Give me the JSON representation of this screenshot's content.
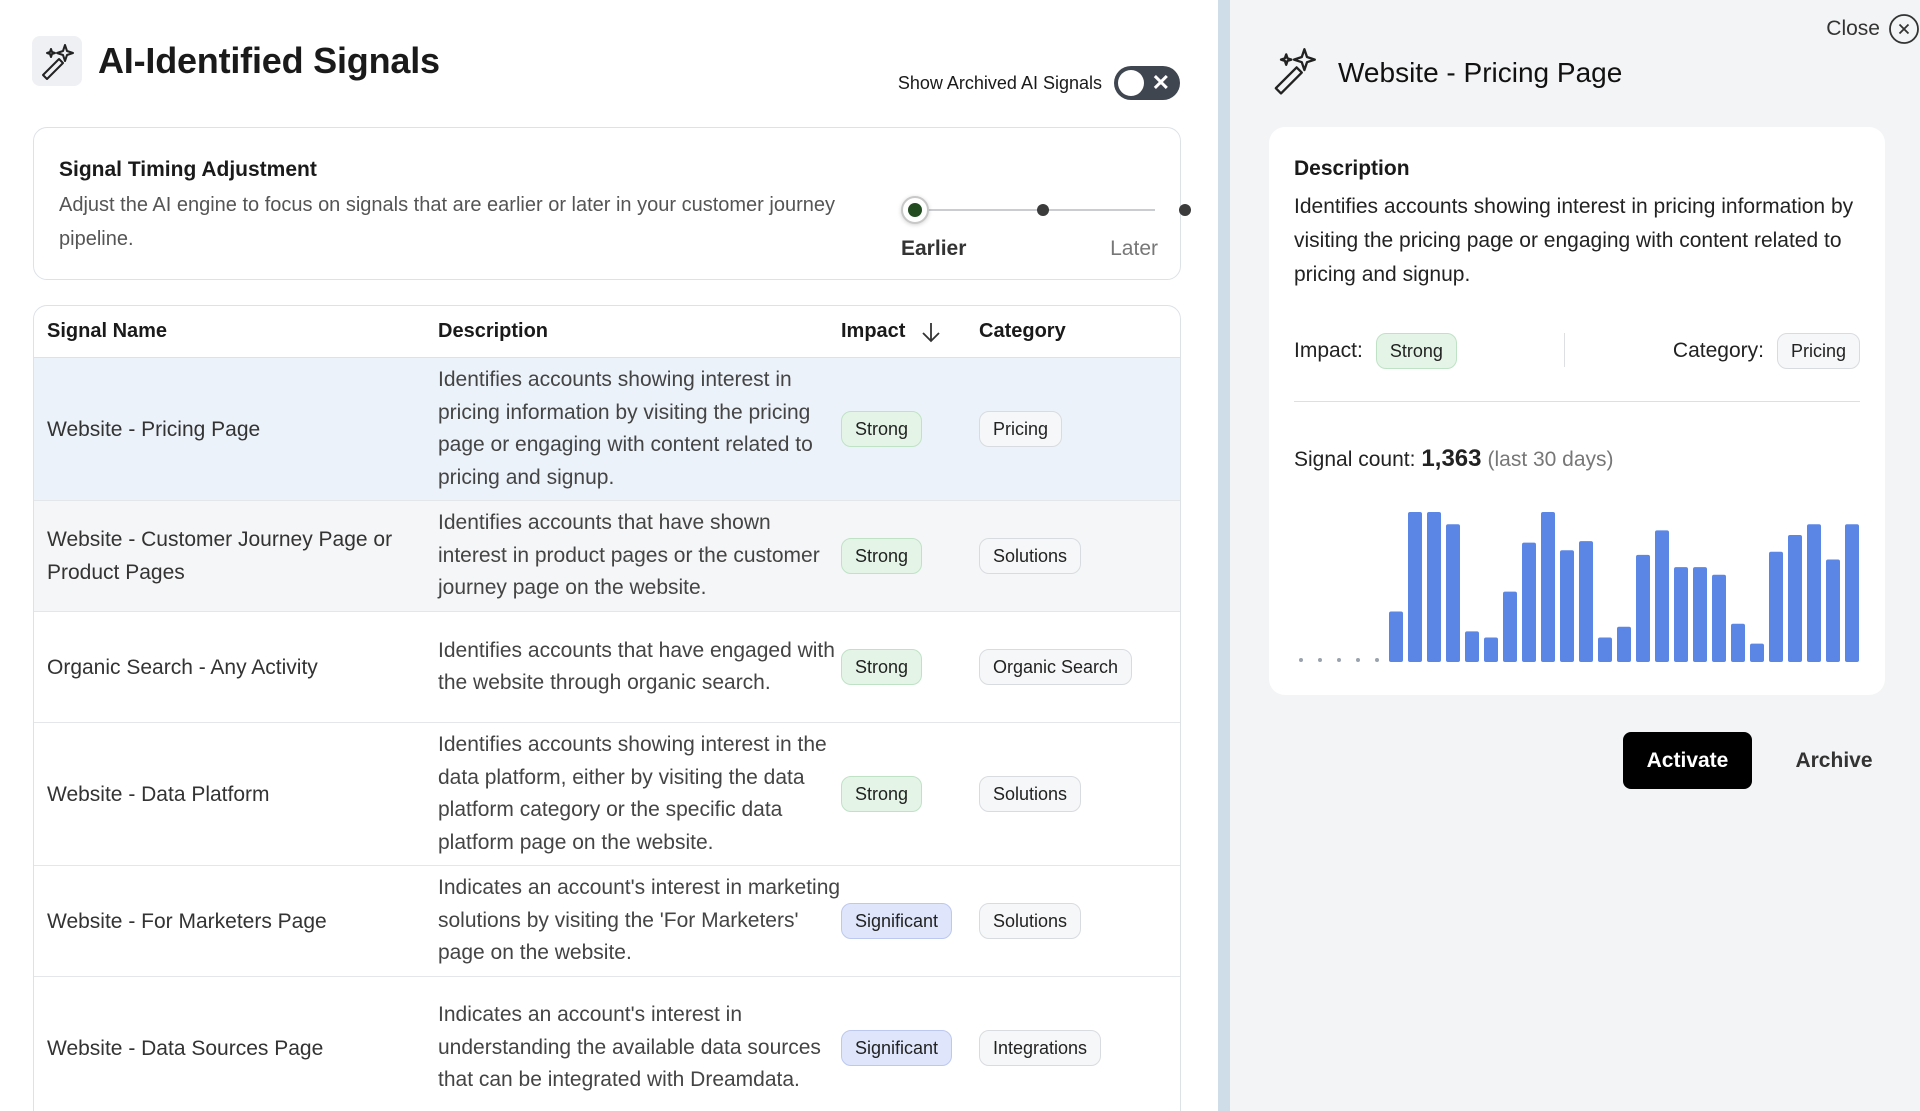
{
  "header": {
    "title": "AI-Identified Signals",
    "icon": "sparkle-wand-icon",
    "archived_toggle_label": "Show Archived AI Signals",
    "archived_toggle_on": false
  },
  "timing": {
    "title": "Signal Timing Adjustment",
    "description": "Adjust the AI engine to focus on signals that are earlier or later in your customer journey pipeline.",
    "earlier_label": "Earlier",
    "later_label": "Later",
    "selected_position": 0,
    "positions": 3
  },
  "table": {
    "headers": {
      "name": "Signal Name",
      "description": "Description",
      "impact": "Impact",
      "category": "Category"
    },
    "rows": [
      {
        "name": "Website - Pricing Page",
        "description": "Identifies accounts showing interest in pricing information by visiting the pricing page or engaging with content related to pricing and signup.",
        "impact": "Strong",
        "category": "Pricing"
      },
      {
        "name": "Website - Customer Journey Page or Product Pages",
        "description": "Identifies accounts that have shown interest in product pages or the customer journey page on the website.",
        "impact": "Strong",
        "category": "Solutions"
      },
      {
        "name": "Organic Search - Any Activity",
        "description": "Identifies accounts that have engaged with the website through organic search.",
        "impact": "Strong",
        "category": "Organic Search"
      },
      {
        "name": "Website - Data Platform",
        "description": "Identifies accounts showing interest in the data platform, either by visiting the data platform category or the specific data platform page on the website.",
        "impact": "Strong",
        "category": "Solutions"
      },
      {
        "name": "Website - For Marketers Page",
        "description": "Indicates an account's interest in marketing solutions by visiting the 'For Marketers' page on the website.",
        "impact": "Significant",
        "category": "Solutions"
      },
      {
        "name": "Website - Data Sources Page",
        "description": "Indicates an account's interest in understanding the available data sources that can be integrated with Dreamdata.",
        "impact": "Significant",
        "category": "Integrations"
      }
    ]
  },
  "detail": {
    "close_label": "Close",
    "title": "Website - Pricing Page",
    "description_title": "Description",
    "description": "Identifies accounts showing interest in pricing information by visiting the pricing page or engaging with content related to pricing and signup.",
    "impact_label": "Impact:",
    "impact": "Strong",
    "category_label": "Category:",
    "category": "Pricing",
    "signal_count_label": "Signal count:",
    "signal_count": "1,363",
    "signal_count_period": "(last 30 days)",
    "activate_label": "Activate",
    "archive_label": "Archive"
  },
  "colors": {
    "bar": "#5b86e5",
    "strong_badge": "#e4f5e7",
    "significant_badge": "#dfe6fb",
    "slider_active": "#234d21"
  },
  "chart_data": {
    "type": "bar",
    "values": [
      0,
      0,
      0,
      0,
      0,
      33,
      98,
      98,
      90,
      20,
      16,
      46,
      78,
      98,
      73,
      79,
      16,
      23,
      70,
      86,
      62,
      62,
      57,
      25,
      12,
      72,
      83,
      90,
      67,
      90
    ]
  }
}
